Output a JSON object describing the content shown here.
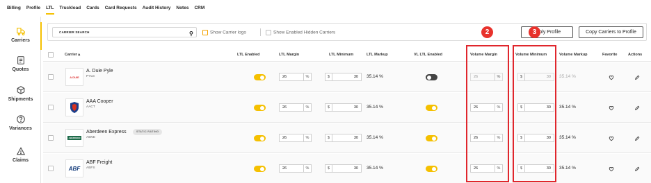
{
  "topnav": [
    "Billing",
    "Profile",
    "LTL",
    "Truckload",
    "Cards",
    "Card Requests",
    "Audit History",
    "Notes",
    "CRM"
  ],
  "active_tab": "LTL",
  "sidebar": [
    {
      "label": "Carriers",
      "icon": "truck-icon",
      "active": true
    },
    {
      "label": "Quotes",
      "icon": "document-icon"
    },
    {
      "label": "Shipments",
      "icon": "box-icon"
    },
    {
      "label": "Variances",
      "icon": "question-icon"
    },
    {
      "label": "Claims",
      "icon": "warning-icon"
    }
  ],
  "toolbar": {
    "search_placeholder": "CARRIER SEARCH",
    "show_logo": "Show Carrier logo",
    "show_hidden": "Show Enabled Hidden Carriers",
    "apply_profile": "Apply Profile",
    "copy_to_profile": "Copy Carriers to Profile"
  },
  "columns": {
    "carrier": "Carrier",
    "ltl_enabled": "LTL Enabled",
    "ltl_margin": "LTL Margin",
    "ltl_minimum": "LTL Minimum",
    "ltl_markup": "LTL Markup",
    "vl_enabled": "VL LTL Enabled",
    "volume_margin": "Volume Margin",
    "volume_minimum": "Volume Minimum",
    "volume_markup": "Volume Markup",
    "favorite": "Favorite",
    "actions": "Actions"
  },
  "rows": [
    {
      "name": "A. Duie Pyle",
      "code": "PYLE",
      "logo": "A.DUIE",
      "ltl_enabled": true,
      "ltl_margin": "26",
      "ltl_minimum": "30",
      "ltl_markup": "35.14 %",
      "vl_enabled": false,
      "volume_margin": "26",
      "volume_minimum": "30",
      "volume_markup": "35.14 %"
    },
    {
      "name": "AAA Cooper",
      "code": "AACT",
      "logo": "AAA",
      "ltl_enabled": true,
      "ltl_margin": "26",
      "ltl_minimum": "30",
      "ltl_markup": "35.14 %",
      "vl_enabled": true,
      "volume_margin": "26",
      "volume_minimum": "30",
      "volume_markup": "35.14 %"
    },
    {
      "name": "Aberdeen Express",
      "code": "ABNE",
      "logo": "ABERDEEN",
      "badge": "STATIC RATING",
      "ltl_enabled": true,
      "ltl_margin": "26",
      "ltl_minimum": "30",
      "ltl_markup": "35.14 %",
      "vl_enabled": true,
      "volume_margin": "26",
      "volume_minimum": "30",
      "volume_markup": "35.14 %"
    },
    {
      "name": "ABF Freight",
      "code": "ABFS",
      "logo": "ABF",
      "ltl_enabled": true,
      "ltl_margin": "26",
      "ltl_minimum": "30",
      "ltl_markup": "35.14 %",
      "vl_enabled": true,
      "volume_margin": "26",
      "volume_minimum": "30",
      "volume_markup": "35.14 %"
    }
  ],
  "units": {
    "percent": "%",
    "dollar": "$"
  },
  "callouts": [
    "2",
    "3"
  ],
  "colors": {
    "accent": "#f5c000",
    "callout": "#e8322c",
    "toggle_off": "#444444"
  }
}
